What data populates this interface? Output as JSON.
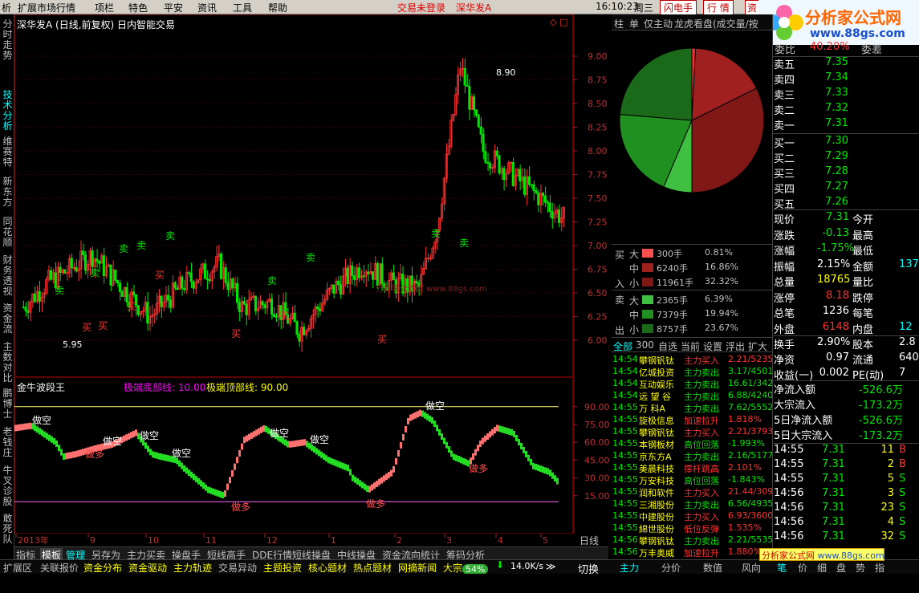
{
  "menu": {
    "items": [
      "析",
      "扩展市场行情",
      "项栏",
      "特色",
      "平安",
      "资讯",
      "工具",
      "帮助"
    ],
    "status_trade": "交易未登录",
    "status_stock": "深华发A",
    "time": "16:10:23",
    "weekday": "周三",
    "btn_flash": "闪电手",
    "btn_quote": "行  情",
    "btn_more": "资"
  },
  "watermark": {
    "brand": "分析家公式网",
    "url": "www.88gs.com"
  },
  "lefttabs": [
    "分时走势",
    "技术分析",
    "维赛特",
    "新东方",
    "同花顺",
    "财务透视",
    "资金流",
    "主数对比",
    "鹏博士",
    "老钱庄",
    "牛叉诊股",
    "敢死队"
  ],
  "main_chart": {
    "title": "深华发A (日线,前复权) 日内智能交易",
    "y_labels": [
      "9.00",
      "8.75",
      "8.50",
      "8.25",
      "8.00",
      "7.75",
      "7.50",
      "7.25",
      "7.00",
      "6.75",
      "6.50",
      "6.25",
      "6.00"
    ],
    "high_label": "8.90",
    "low_label": "5.95",
    "signals_buy": [
      "买",
      "买",
      "买",
      "买",
      "买",
      "买",
      "买"
    ],
    "signals_sell": [
      "卖",
      "卖",
      "卖",
      "卖",
      "卖",
      "卖",
      "卖",
      "卖",
      "卖"
    ],
    "watermark": "分析家公式网 www.88gs.com"
  },
  "indicator": {
    "name": "金牛波段王",
    "param1": "极端底部线: 10.00",
    "param2": "极端顶部线: 90.00",
    "y_labels": [
      "90.00",
      "75.00",
      "60.00",
      "45.00",
      "30.00",
      "15.00"
    ],
    "tags_kong": [
      "做空",
      "做空",
      "做空",
      "做空",
      "做空",
      "做空",
      "做空"
    ],
    "tags_duo": [
      "做多",
      "做多",
      "做多",
      "做多",
      "做多"
    ]
  },
  "x_axis": {
    "labels": [
      "2013年",
      "9",
      "10",
      "11",
      "12",
      "1",
      "2",
      "3",
      "4",
      "5"
    ],
    "period": "日线"
  },
  "right_tabs": [
    "柱",
    "单",
    "仅主动",
    "龙虎看盘(成交量/按"
  ],
  "pie": {
    "slices": [
      {
        "label": "大买",
        "value": 0.81,
        "color": "#ff3030"
      },
      {
        "label": "中买",
        "value": 16.86,
        "color": "#a02020"
      },
      {
        "label": "小买",
        "value": 32.32,
        "color": "#801818"
      },
      {
        "label": "大卖",
        "value": 6.39,
        "color": "#40c040"
      },
      {
        "label": "中卖",
        "value": 19.94,
        "color": "#209020"
      },
      {
        "label": "小卖",
        "value": 23.67,
        "color": "#1a6a1a"
      }
    ]
  },
  "flow_table": {
    "buy_side": "买",
    "buy_side2": "入",
    "sell_side": "卖",
    "sell_side2": "出",
    "rows": [
      {
        "size": "大",
        "vol": "300手",
        "pct": "0.81%",
        "color": "#ff5050"
      },
      {
        "size": "中",
        "vol": "6240手",
        "pct": "16.86%",
        "color": "#a02020"
      },
      {
        "size": "小",
        "vol": "11961手",
        "pct": "32.32%",
        "color": "#801818"
      },
      {
        "size": "大",
        "vol": "2365手",
        "pct": "6.39%",
        "color": "#40c040"
      },
      {
        "size": "中",
        "vol": "7379手",
        "pct": "19.94%",
        "color": "#209020"
      },
      {
        "size": "小",
        "vol": "8757手",
        "pct": "23.67%",
        "color": "#1a6a1a"
      }
    ]
  },
  "filter_tabs": [
    "全部",
    "300",
    "自选",
    "当前",
    "设置",
    "浮出",
    "扩大"
  ],
  "news": [
    {
      "t": "14:54",
      "name": "攀钢钒钛",
      "act": "主力买入",
      "val": "2.21/5235"
    },
    {
      "t": "14:54",
      "name": "亿城投资",
      "act": "主力卖出",
      "val": "3.17/4501"
    },
    {
      "t": "14:54",
      "name": "互动娱乐",
      "act": "主力卖出",
      "val": "16.61/342"
    },
    {
      "t": "14:54",
      "name": "远 望 谷",
      "act": "主力卖出",
      "val": "6.88/4240"
    },
    {
      "t": "14:55",
      "name": "万  科A",
      "act": "主力卖出",
      "val": "7.62/5552"
    },
    {
      "t": "14:55",
      "name": "旋极信息",
      "act": "加速拉升",
      "val": "1.818%"
    },
    {
      "t": "14:55",
      "name": "攀钢钒钛",
      "act": "主力买入",
      "val": "2.21/3793"
    },
    {
      "t": "14:55",
      "name": "本钢板材",
      "act": "高位回落",
      "val": "-1.993%"
    },
    {
      "t": "14:55",
      "name": "京东方A",
      "act": "主力卖出",
      "val": "2.16/5177"
    },
    {
      "t": "14:55",
      "name": "美晨科技",
      "act": "撑杆跳高",
      "val": "2.101%"
    },
    {
      "t": "14:55",
      "name": "万安科技",
      "act": "高位回落",
      "val": "-1.843%"
    },
    {
      "t": "14:55",
      "name": "润和软件",
      "act": "主力买入",
      "val": "21.44/309"
    },
    {
      "t": "14:55",
      "name": "三湘股份",
      "act": "主力卖出",
      "val": "6.56/4935"
    },
    {
      "t": "14:55",
      "name": "中建股份",
      "act": "主力买入",
      "val": "6.93/3600"
    },
    {
      "t": "14:55",
      "name": "綿世股份",
      "act": "低位反弹",
      "val": "1.535%"
    },
    {
      "t": "14:56",
      "name": "攀钢钒钛",
      "act": "主力卖出",
      "val": "2.21/5535"
    },
    {
      "t": "14:56",
      "name": "万丰奥威",
      "act": "加速拉升",
      "val": "1.880%"
    }
  ],
  "orderbook": {
    "top_label": "委比",
    "top_val": "40.20%",
    "top_right": "委差",
    "asks": [
      {
        "l": "卖五",
        "p": "7.35"
      },
      {
        "l": "卖四",
        "p": "7.34"
      },
      {
        "l": "卖三",
        "p": "7.33"
      },
      {
        "l": "卖二",
        "p": "7.32"
      },
      {
        "l": "卖一",
        "p": "7.31"
      }
    ],
    "bids": [
      {
        "l": "买一",
        "p": "7.30"
      },
      {
        "l": "买二",
        "p": "7.29"
      },
      {
        "l": "买三",
        "p": "7.28"
      },
      {
        "l": "买四",
        "p": "7.27"
      },
      {
        "l": "买五",
        "p": "7.26"
      }
    ]
  },
  "quote": [
    {
      "l": "现价",
      "v": "7.31",
      "c": "#00e600",
      "l2": "今开",
      "v2": ""
    },
    {
      "l": "涨跌",
      "v": "-0.13",
      "c": "#00e600",
      "l2": "最高",
      "v2": ""
    },
    {
      "l": "涨幅",
      "v": "-1.75%",
      "c": "#00e600",
      "l2": "最低",
      "v2": ""
    },
    {
      "l": "振幅",
      "v": "2.15%",
      "c": "#ffffff",
      "l2": "金额",
      "v2": "137"
    },
    {
      "l": "总量",
      "v": "18765",
      "c": "#ffff00",
      "l2": "量比",
      "v2": ""
    },
    {
      "l": "涨停",
      "v": "8.18",
      "c": "#ff3232",
      "l2": "跌停",
      "v2": ""
    },
    {
      "l": "总笔",
      "v": "1236",
      "c": "#ffffff",
      "l2": "每笔",
      "v2": ""
    },
    {
      "l": "外盘",
      "v": "6148",
      "c": "#ff3232",
      "l2": "内盘",
      "v2": "12"
    }
  ],
  "quote2": [
    {
      "l": "换手",
      "v": "2.90%",
      "l2": "股本",
      "v2": "2.8"
    },
    {
      "l": "净资",
      "v": "0.97",
      "l2": "流通",
      "v2": "640"
    },
    {
      "l": "收益(一)",
      "v": "0.002",
      "l2": "PE(动)",
      "v2": "7"
    }
  ],
  "flows": [
    {
      "l": "净流入额",
      "v": "-526.6万"
    },
    {
      "l": "大宗流入",
      "v": "-173.2万"
    },
    {
      "l": "5日净流入额",
      "v": "-526.6万"
    },
    {
      "l": "5日大宗流入",
      "v": "-173.2万"
    }
  ],
  "ticks": [
    {
      "t": "14:55",
      "p": "7.31",
      "n": "11",
      "d": "B"
    },
    {
      "t": "14:55",
      "p": "7.31",
      "n": "2",
      "d": "B"
    },
    {
      "t": "14:55",
      "p": "7.31",
      "n": "5",
      "d": "S"
    },
    {
      "t": "14:56",
      "p": "7.31",
      "n": "3",
      "d": "S"
    },
    {
      "t": "14:56",
      "p": "7.31",
      "n": "23",
      "d": "S"
    },
    {
      "t": "14:56",
      "p": "7.31",
      "n": "4",
      "d": "S"
    },
    {
      "t": "14:56",
      "p": "7.31",
      "n": "32",
      "d": "S"
    }
  ],
  "toolbar": [
    "指标",
    "模板",
    "管理",
    "另存为",
    "主力买卖",
    "操盘手",
    "短线高手",
    "DDE行情",
    "短线操盘",
    "中线操盘",
    "资金流向统计",
    "筹码分析"
  ],
  "statusbar": [
    "扩展区",
    "关联报价",
    "资金分布",
    "资金驱动",
    "主力轨迹",
    "交易异动",
    "主题投资",
    "核心题材",
    "热点题材",
    "网摘新闻",
    "大宗"
  ],
  "netspeed": "14.0K/s",
  "percent": "54%",
  "switch": "切换",
  "right_bottom_tabs": [
    "主力",
    "分价",
    "数值",
    "风向"
  ],
  "right_bottom_tabs2": [
    "笔",
    "价",
    "细",
    "盘",
    "势",
    "指"
  ]
}
